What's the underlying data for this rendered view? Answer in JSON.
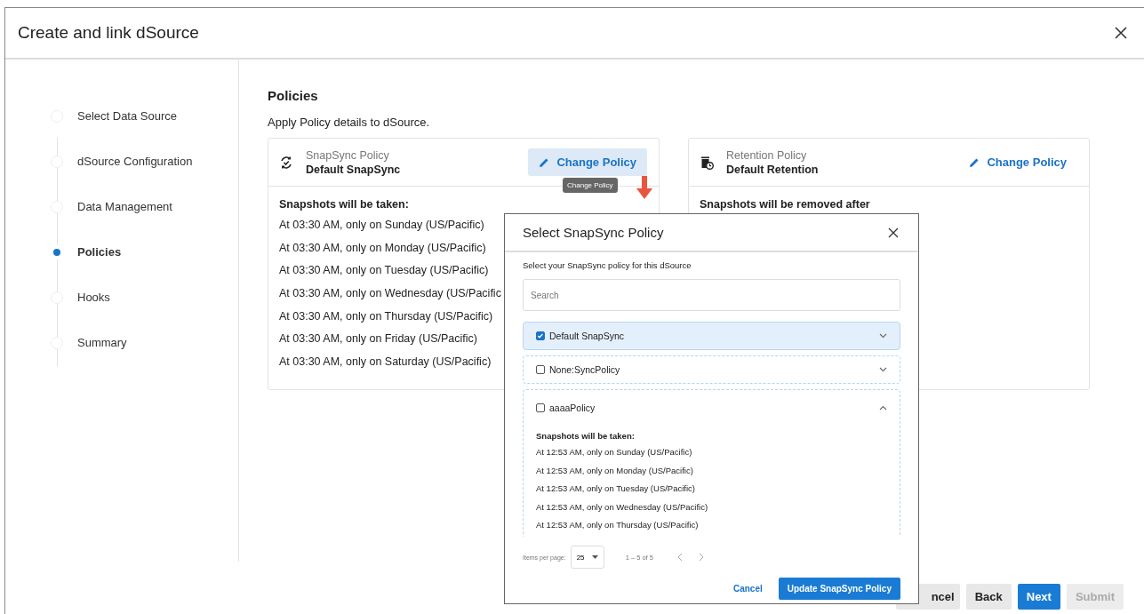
{
  "window": {
    "title": "Create and link dSource"
  },
  "steps": [
    {
      "label": "Select Data Source",
      "selected": false
    },
    {
      "label": "dSource Configuration",
      "selected": false
    },
    {
      "label": "Data Management",
      "selected": false
    },
    {
      "label": "Policies",
      "selected": true
    },
    {
      "label": "Hooks",
      "selected": false
    },
    {
      "label": "Summary",
      "selected": false
    }
  ],
  "section": {
    "title": "Policies",
    "description": "Apply Policy details to dSource."
  },
  "policy_cards": [
    {
      "kind": "snapsync",
      "type_label": "SnapSync Policy",
      "name": "Default SnapSync",
      "action": "Change Policy",
      "hovered": true,
      "tooltip": "Change Policy",
      "heading": "Snapshots will be taken:",
      "lines": [
        "At 03:30 AM, only on Sunday (US/Pacific)",
        "At 03:30 AM, only on Monday (US/Pacific)",
        "At 03:30 AM, only on Tuesday (US/Pacific)",
        "At 03:30 AM, only on Wednesday (US/Pacific",
        "At 03:30 AM, only on Thursday (US/Pacific)",
        "At 03:30 AM, only on Friday (US/Pacific)",
        "At 03:30 AM, only on Saturday (US/Pacific)"
      ]
    },
    {
      "kind": "retention",
      "type_label": "Retention Policy",
      "name": "Default Retention",
      "action": "Change Policy",
      "hovered": false,
      "heading": "Snapshots will be removed after"
    }
  ],
  "footer_buttons": [
    {
      "label": "ncel",
      "kind": "secondary",
      "disabled": false
    },
    {
      "label": "Back",
      "kind": "secondary",
      "disabled": false
    },
    {
      "label": "Next",
      "kind": "primary",
      "disabled": false
    },
    {
      "label": "Submit",
      "kind": "secondary",
      "disabled": true
    }
  ],
  "dialog": {
    "title": "Select SnapSync Policy",
    "description": "Select your SnapSync policy for this dSource",
    "search": {
      "placeholder": "Search"
    },
    "policies": [
      {
        "name": "Default SnapSync",
        "checked": true,
        "selected": true,
        "expanded": false
      },
      {
        "name": "None:SyncPolicy",
        "checked": false,
        "selected": false,
        "expanded": false
      },
      {
        "name": "aaaaPolicy",
        "checked": false,
        "selected": false,
        "expanded": true,
        "heading": "Snapshots will be taken:",
        "lines": [
          "At 12:53 AM, only on Sunday (US/Pacific)",
          "At 12:53 AM, only on Monday (US/Pacific)",
          "At 12:53 AM, only on Tuesday (US/Pacific)",
          "At 12:53 AM, only on Wednesday (US/Pacific)",
          "At 12:53 AM, only on Thursday (US/Pacific)"
        ]
      }
    ],
    "pagination": {
      "label": "Items per page:",
      "page_size": "25",
      "range": "1 – 5 of 5"
    },
    "cancel": "Cancel",
    "submit": "Update SnapSync Policy"
  }
}
